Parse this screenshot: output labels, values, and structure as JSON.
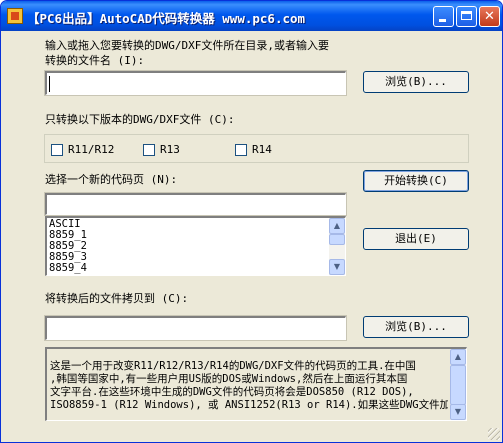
{
  "window": {
    "title": "【PC6出品】AutoCAD代码转换器 www.pc6.com",
    "minimize_glyph": "",
    "maximize_glyph": "",
    "close_glyph": "✕"
  },
  "source": {
    "label_line1": "输入或拖入您要转换的DWG/DXF文件所在目录,或者输入要",
    "label_line2": "转换的文件名 (I):",
    "path_value": "",
    "browse_label": "浏览(B)..."
  },
  "versions": {
    "label": "只转换以下版本的DWG/DXF文件 (C):",
    "options": [
      {
        "label": "R11/R12",
        "checked": false
      },
      {
        "label": "R13",
        "checked": false
      },
      {
        "label": "R14",
        "checked": false
      }
    ]
  },
  "codepage": {
    "label": "选择一个新的代码页 (N):",
    "selected_value": "",
    "items": [
      "ASCII",
      "8859_1",
      "8859_2",
      "8859_3",
      "8859_4"
    ]
  },
  "actions": {
    "start_label": "开始转换(C)",
    "exit_label": "退出(E)"
  },
  "copy_target": {
    "label": "将转换后的文件拷贝到 (C):",
    "path_value": "",
    "browse_label": "浏览(B)..."
  },
  "description": {
    "lines": [
      "这是一个用于改变R11/R12/R13/R14的DWG/DXF文件的代码页的工具.在中国",
      ",韩国等国家中,有一些用户用US版的DOS或Windows,然后在上面运行其本国",
      "文字平台.在这些环境中生成的DWG文件的代码页将会是DOS850 (R12 DOS),",
      "ISO8859-1 (R12 Windows), 或 ANSI1252(R13 or R14).如果这些DWG文件加"
    ]
  },
  "icons": {
    "app": "app-icon",
    "scroll_up": "▲",
    "scroll_down": "▼"
  }
}
